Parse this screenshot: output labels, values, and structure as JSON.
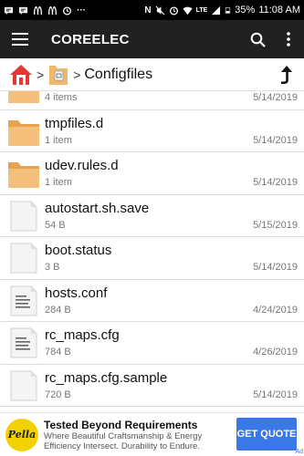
{
  "status_bar": {
    "battery": "35%",
    "time": "11:08 AM",
    "network": "LTE",
    "icons": [
      "message-icon",
      "message-icon",
      "mcdonalds-icon",
      "mcdonalds-icon",
      "alarm-icon",
      "dots-icon",
      "nfc-icon",
      "mute-icon",
      "alarm-icon",
      "wifi-icon",
      "signal-icon",
      "battery-icon"
    ]
  },
  "toolbar": {
    "title": "COREELEC",
    "icons": [
      "menu-icon",
      "search-icon",
      "overflow-icon"
    ]
  },
  "breadcrumb": {
    "current": "Configfiles",
    "separator": ">",
    "icons": [
      "home-icon",
      "folder-icon",
      "up-arrow-icon"
    ]
  },
  "files": [
    {
      "name": "",
      "meta": "4 items",
      "date": "5/14/2019",
      "icon": "folder-icon"
    },
    {
      "name": "tmpfiles.d",
      "meta": "1 item",
      "date": "5/14/2019",
      "icon": "folder-icon"
    },
    {
      "name": "udev.rules.d",
      "meta": "1 item",
      "date": "5/14/2019",
      "icon": "folder-icon"
    },
    {
      "name": "autostart.sh.save",
      "meta": "54 B",
      "date": "5/15/2019",
      "icon": "file-icon"
    },
    {
      "name": "boot.status",
      "meta": "3 B",
      "date": "5/14/2019",
      "icon": "file-icon"
    },
    {
      "name": "hosts.conf",
      "meta": "284 B",
      "date": "4/24/2019",
      "icon": "text-file-icon"
    },
    {
      "name": "rc_maps.cfg",
      "meta": "784 B",
      "date": "4/26/2019",
      "icon": "text-file-icon"
    },
    {
      "name": "rc_maps.cfg.sample",
      "meta": "720 B",
      "date": "5/14/2019",
      "icon": "file-icon"
    },
    {
      "name": "",
      "meta": "",
      "date": "",
      "icon": "file-icon"
    }
  ],
  "ad": {
    "logo_text": "Pella",
    "headline": "Tested Beyond Requirements",
    "body": "Where Beautiful Craftsmanship & Energy Efficiency Intersect. Durability to Endure.",
    "cta": "GET QUOTE",
    "badge": "Ad"
  },
  "colors": {
    "toolbar": "#212121",
    "statusbar": "#000000",
    "folder": "#f0b86a",
    "cta": "#3b78e7"
  }
}
